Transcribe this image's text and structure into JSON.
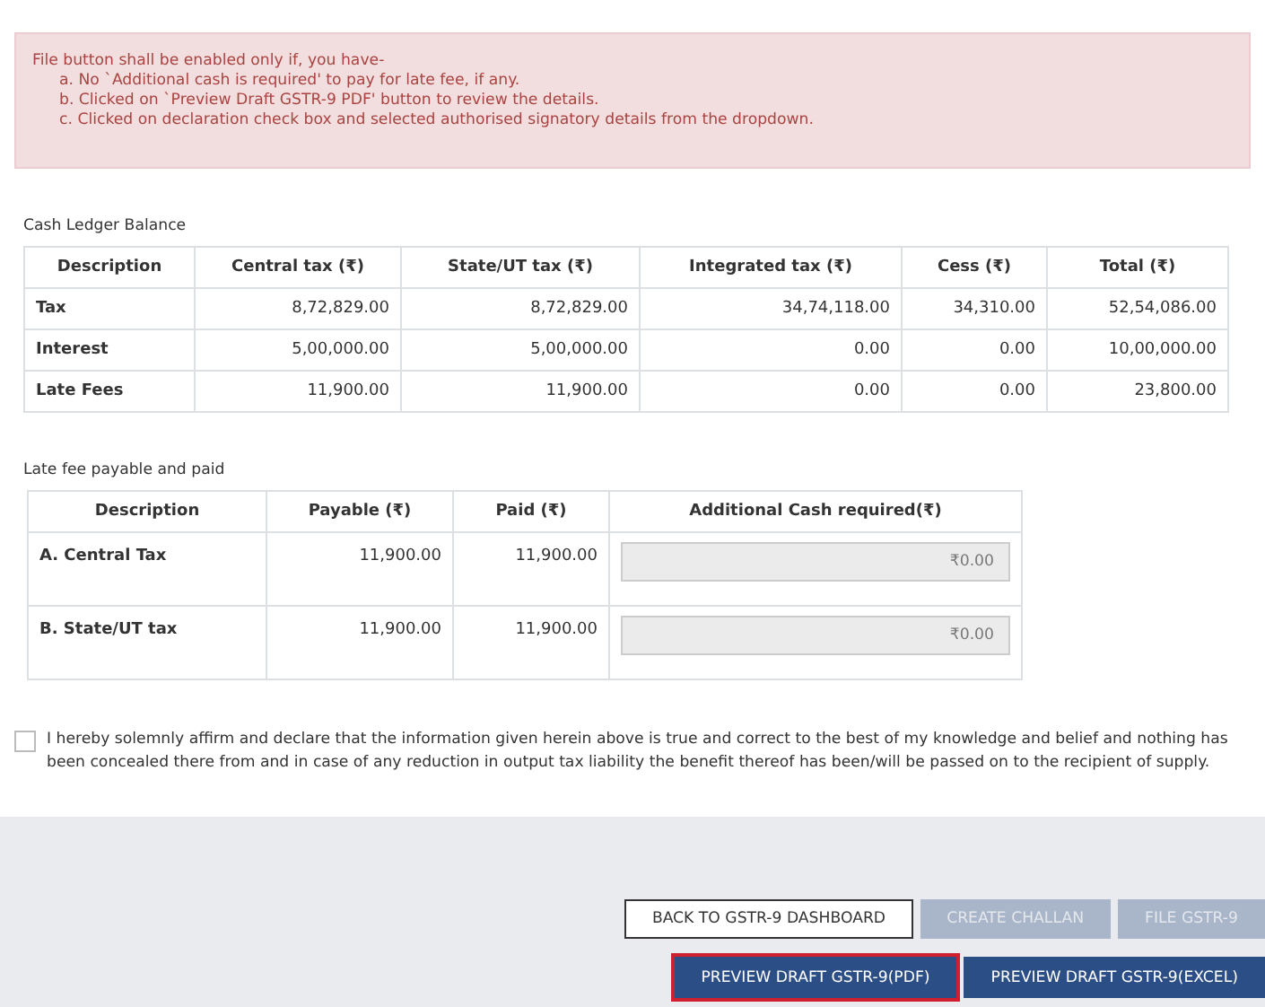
{
  "notice": {
    "intro": "File button shall be enabled only if, you have-",
    "items": [
      "a. No `Additional cash is required' to pay for late fee, if any.",
      "b. Clicked on `Preview Draft GSTR-9 PDF' button to review the details.",
      "c. Clicked on declaration check box and selected authorised signatory details from the dropdown."
    ]
  },
  "cash_ledger": {
    "title": "Cash Ledger Balance",
    "columns": [
      "Description",
      "Central tax (₹)",
      "State/UT tax (₹)",
      "Integrated tax (₹)",
      "Cess (₹)",
      "Total (₹)"
    ],
    "rows": [
      [
        "Tax",
        "8,72,829.00",
        "8,72,829.00",
        "34,74,118.00",
        "34,310.00",
        "52,54,086.00"
      ],
      [
        "Interest",
        "5,00,000.00",
        "5,00,000.00",
        "0.00",
        "0.00",
        "10,00,000.00"
      ],
      [
        "Late Fees",
        "11,900.00",
        "11,900.00",
        "0.00",
        "0.00",
        "23,800.00"
      ]
    ]
  },
  "late_fee": {
    "title": "Late fee payable and paid",
    "columns": [
      "Description",
      "Payable (₹)",
      "Paid (₹)",
      "Additional Cash required(₹)"
    ],
    "rows": [
      {
        "description": "A. Central Tax",
        "payable": "11,900.00",
        "paid": "11,900.00",
        "additional_cash": "₹0.00"
      },
      {
        "description": "B. State/UT tax",
        "payable": "11,900.00",
        "paid": "11,900.00",
        "additional_cash": "₹0.00"
      }
    ]
  },
  "declaration": {
    "checked": false,
    "text": "I hereby solemnly affirm and declare that the information given herein above is true and correct to the best of my knowledge and belief and nothing has been concealed there from and in case of any reduction in output tax liability the benefit thereof has been/will be passed on to the recipient of supply."
  },
  "button_rows": [
    [
      {
        "label": "BACK TO GSTR-9 DASHBOARD",
        "kind": "secondary",
        "disabled": false,
        "highlighted": false
      },
      {
        "label": "CREATE CHALLAN",
        "kind": "primary",
        "disabled": true,
        "highlighted": false
      },
      {
        "label": "FILE GSTR-9",
        "kind": "primary",
        "disabled": true,
        "highlighted": false
      }
    ],
    [
      {
        "label": "PREVIEW DRAFT GSTR-9(PDF)",
        "kind": "primary",
        "disabled": false,
        "highlighted": true
      },
      {
        "label": "PREVIEW DRAFT GSTR-9(EXCEL)",
        "kind": "primary",
        "disabled": false,
        "highlighted": false
      }
    ]
  ]
}
